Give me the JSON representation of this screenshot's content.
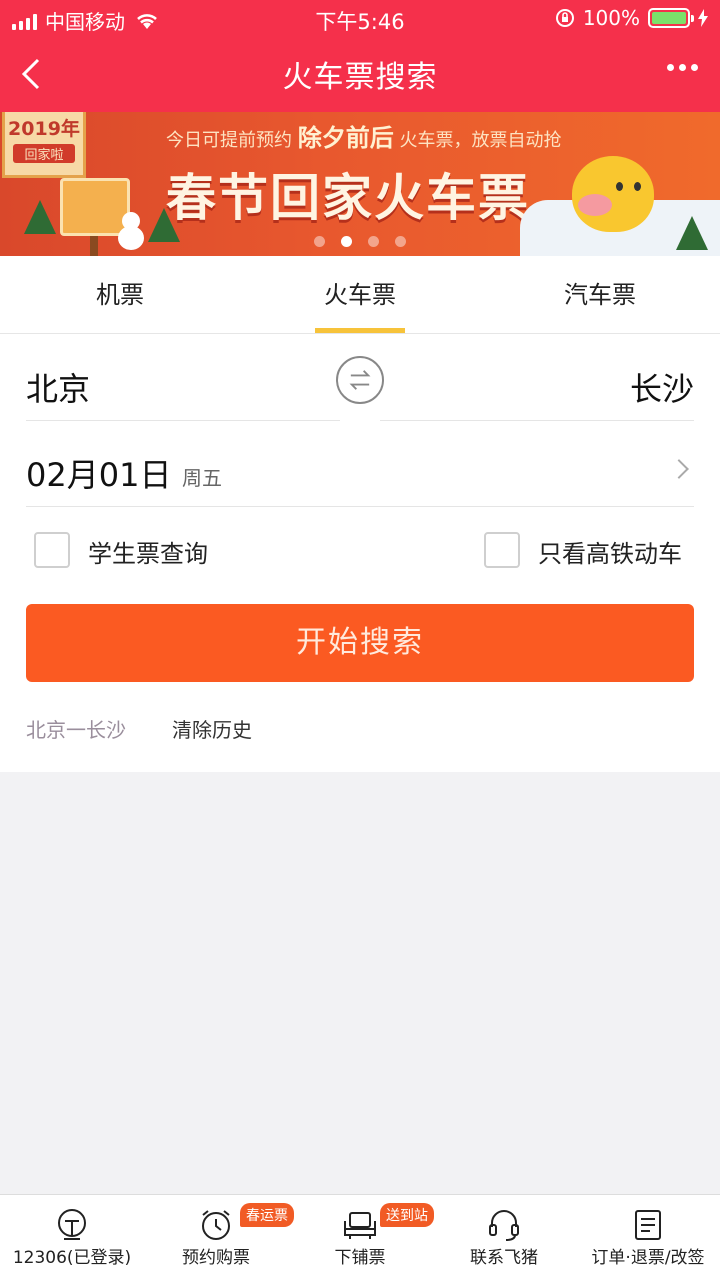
{
  "status_bar": {
    "carrier": "中国移动",
    "time": "下午5:46",
    "battery": "100%",
    "icons": [
      "signal-icon",
      "wifi-icon",
      "rotation-lock-icon",
      "battery-icon",
      "charging-icon"
    ]
  },
  "nav": {
    "title": "火车票搜索",
    "back_icon": "back-arrow-icon",
    "more_icon": "more-dots-icon"
  },
  "banner": {
    "year_tag": "2019年",
    "year_sub": "回家啦",
    "subline_prefix": "今日可提前预约",
    "subline_highlight": "除夕前后",
    "subline_suffix": "火车票，放票自动抢",
    "headline": "春节回家火车票",
    "page_count": 4,
    "active_page": 2
  },
  "tabs": [
    {
      "label": "机票",
      "active": false
    },
    {
      "label": "火车票",
      "active": true
    },
    {
      "label": "汽车票",
      "active": false
    }
  ],
  "form": {
    "from_city": "北京",
    "to_city": "长沙",
    "swap_icon": "swap-arrows-icon",
    "date": "02月01日",
    "weekday": "周五",
    "student_label": "学生票查询",
    "highspeed_label": "只看高铁动车",
    "search_label": "开始搜索",
    "history_item": "北京一长沙",
    "clear_history": "清除历史"
  },
  "bottom_bar": [
    {
      "label": "12306(已登录)",
      "icon": "train-12306-icon"
    },
    {
      "label": "预约购票",
      "icon": "alarm-clock-icon",
      "badge": "春运票"
    },
    {
      "label": "下铺票",
      "icon": "seat-icon",
      "badge": "送到站"
    },
    {
      "label": "联系飞猪",
      "icon": "headset-icon"
    },
    {
      "label": "订单·退票/改签",
      "icon": "order-list-icon"
    }
  ],
  "colors": {
    "header": "#f5304b",
    "search_button": "#fb5a22",
    "tab_indicator": "#f7c33a",
    "badge": "#f15b25"
  }
}
